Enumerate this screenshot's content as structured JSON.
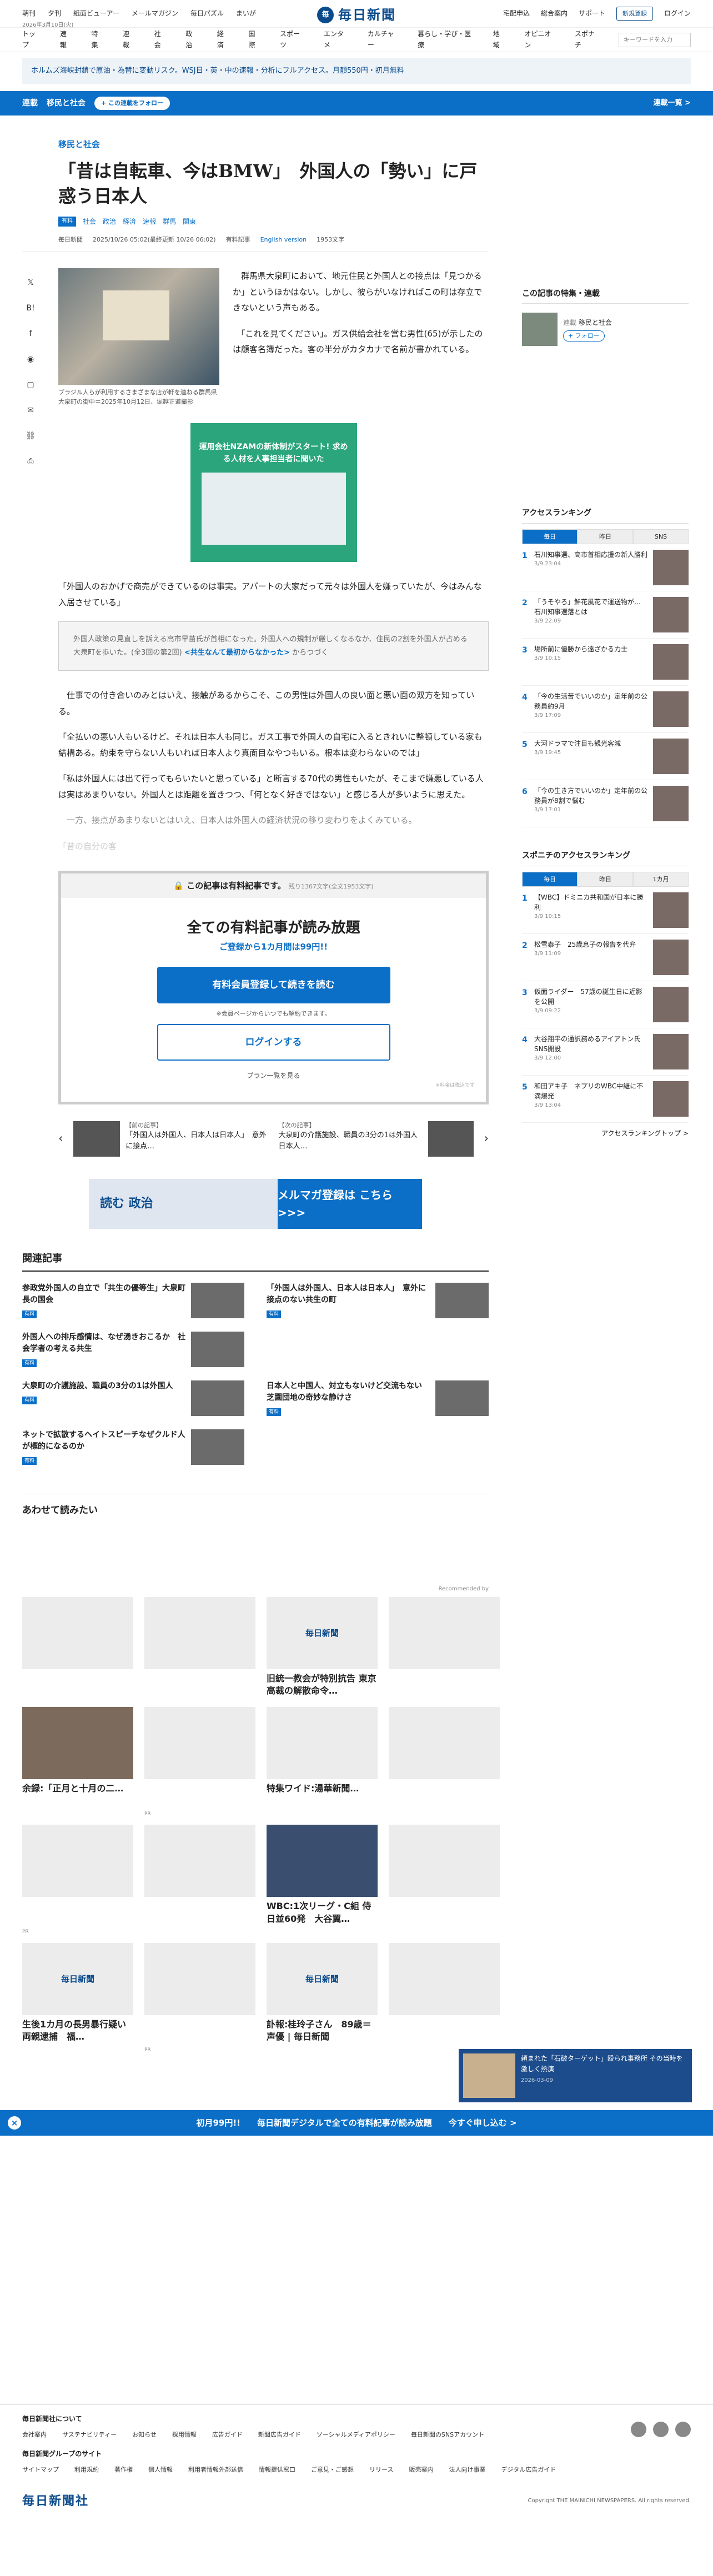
{
  "top": {
    "links": [
      "朝刊",
      "夕刊",
      "紙面ビューアー",
      "メールマガジン",
      "毎日パズル",
      "まいが"
    ],
    "date": "2026年3月10日(火)",
    "logo_mark": "毎",
    "logo": "毎日新聞",
    "right": [
      "宅配申込",
      "総合案内",
      "サポート"
    ],
    "register": "新規登録",
    "login": "ログイン"
  },
  "gnav": {
    "items": [
      "トップ",
      "速報",
      "特集",
      "連載",
      "社会",
      "政治",
      "経済",
      "国際",
      "スポーツ",
      "エンタメ",
      "カルチャー",
      "暮らし・学び・医療",
      "地域",
      "オピニオン",
      "スポナチ"
    ],
    "search_placeholder": "キーワードを入力"
  },
  "ticker": "ホルムズ海峡封鎖で原油・為替に変動リスク。WSJ日・英・中の速報・分析にフルアクセス。月額550円・初月無料",
  "section": {
    "prefix": "連載",
    "name": "移民と社会",
    "follow": "+ この連載をフォロー",
    "more": "連載一覧 >"
  },
  "article": {
    "kicker": "移民と社会",
    "title": "「昔は自転車、今はBMW」　外国人の「勢い」に戸惑う日本人",
    "pay_tag": "有料",
    "tags": [
      "社会",
      "政治",
      "経済",
      "速報",
      "群馬",
      "関東"
    ],
    "meta": {
      "author": "毎日新聞",
      "date": "2025/10/26 05:02(最終更新 10/26 06:02)",
      "paid": "有料記事",
      "english": "English version",
      "chars": "1953文字"
    },
    "caption": "ブラジル人らが利用するさまざまな店が軒を連ねる群馬県大泉町の街中＝2025年10月12日、堀越正道撮影",
    "paragraphs": [
      "　群馬県大泉町において、地元住民と外国人との接点は「見つかるか」というほかはない。しかし、彼らがいなければこの町は存立できないという声もある。",
      "　「これを見てください」。ガス供給会社を営む男性(65)が示したのは顧客名簿だった。客の半分がカタカナで名前が書かれている。"
    ],
    "ad": "運用会社NZAMの新体制がスタート! 求める人材を人事担当者に聞いた",
    "p3": "「外国人のおかげで商売ができているのは事実。アパートの大家だって元々は外国人を嫌っていたが、今はみんな入居させている」",
    "box_text": "外国人政策の見直しを訴える高市早苗氏が首相になった。外国人への規制が厳しくなるなか、住民の2割を外国人が占める大泉町を歩いた。(全3回の第2回)",
    "box_link": "<共生なんて最初からなかった>",
    "box_link_suffix": "からつづく",
    "paragraphs2": [
      "　仕事での付き合いのみとはいえ、接触があるからこそ、この男性は外国人の良い面と悪い面の双方を知っている。",
      "「全払いの悪い人もいるけど、それは日本人も同じ。ガス工事で外国人の自宅に入るときれいに整頓している家も結構ある。約束を守らない人もいれば日本人より真面目なやつもいる。根本は変わらないのでは」",
      "「私は外国人には出て行ってもらいたいと思っている」と断言する70代の男性もいたが、そこまで嫌悪している人は実はあまりいない。外国人とは距離を置きつつ、「何となく好きではない」と感じる人が多いように思えた。"
    ],
    "fade": [
      "　一方、接点があまりないとはいえ、日本人は外国人の経済状況の移り変わりをよくみている。",
      "「昔の自分の客"
    ]
  },
  "paywall": {
    "head": "この記事は有料記事です。",
    "remain": "残り1367文字(全文1953文字)",
    "title": "全ての有料記事が読み放題",
    "sub": "ご登録から1カ月間は99円!!",
    "primary": "有料会員登録して続きを読む",
    "note": "※会員ページからいつでも解約できます。",
    "login": "ログインする",
    "plans": "プラン一覧を見る",
    "fine": "※料金は税込です"
  },
  "prevnext": {
    "prev_label": "【前の記事】",
    "prev_title": "「外国人は外国人、日本人は日本人」　意外に接点…",
    "next_label": "【次の記事】",
    "next_title": "大泉町の介護施設、職員の3分の1は外国人　日本人…"
  },
  "banner": {
    "left": "読む 政治",
    "right": "メルマガ登録は こちら >>>"
  },
  "related": {
    "title": "関連記事",
    "items": [
      {
        "t": "参政党外国人の自立で「共生の優等生」大泉町長の国会",
        "pill": "有料"
      },
      {
        "t": "「外国人は外国人、日本人は日本人」　意外に接点のない共生の町",
        "pill": "有料"
      },
      {
        "t": "外国人への排斥感情は、なぜ湧きおこるか　社会学者の考える共生",
        "pill": "有料"
      },
      {
        "t": "",
        "pill": ""
      },
      {
        "t": "大泉町の介護施設、職員の3分の1は外国人",
        "pill": "有料"
      },
      {
        "t": "日本人と中国人、対立もないけど交流もない　芝園団地の奇妙な静けさ",
        "pill": "有料"
      },
      {
        "t": "ネットで拡散するヘイトスピーチなぜクルド人が標的になるのか",
        "pill": "有料"
      }
    ]
  },
  "aw": {
    "title": "あわせて読みたい",
    "recommended": "Recommended by",
    "cards": [
      {
        "t": "",
        "pr": "",
        "ph": ""
      },
      {
        "t": "",
        "pr": "",
        "ph": ""
      },
      {
        "t": "旧統一教会が特別抗告 東京高裁の解散命令…",
        "pr": "",
        "ph": "毎日新聞"
      },
      {
        "t": "",
        "pr": "",
        "ph": ""
      },
      {
        "t": "余録:「正月と十月の二…",
        "pr": "",
        "ph": ""
      },
      {
        "t": "",
        "pr": "PR",
        "ph": ""
      },
      {
        "t": "特集ワイド:湯華新聞…",
        "pr": "",
        "ph": ""
      },
      {
        "t": "",
        "pr": "",
        "ph": ""
      },
      {
        "t": "",
        "pr": "PR",
        "ph": ""
      },
      {
        "t": "",
        "pr": "",
        "ph": ""
      },
      {
        "t": "WBC:1次リーグ・C組 侍日並60発　大谷翼…",
        "pr": "",
        "ph": ""
      },
      {
        "t": "",
        "pr": "",
        "ph": ""
      },
      {
        "t": "生後1カ月の長男暴行疑い　両親逮捕　福…",
        "pr": "",
        "ph": "毎日新聞"
      },
      {
        "t": "",
        "pr": "PR",
        "ph": ""
      },
      {
        "t": "訃報:桂玲子さん　89歳＝声優 | 毎日新聞",
        "pr": "",
        "ph": "毎日新聞"
      },
      {
        "t": "",
        "pr": "",
        "ph": ""
      }
    ]
  },
  "sticky": {
    "close": "×",
    "a": "初月99円!!",
    "b": "毎日新聞デジタルで全ての有料記事が読み放題",
    "c": "今すぐ申し込む >"
  },
  "floatad": {
    "text": "頼まれた「石破ターゲット」殴られ事務所 その当時を激しく熱演",
    "time": "2026-03-09"
  },
  "side": {
    "series_title": "この記事の特集・連載",
    "series_tag": "連載",
    "series_name": "移民と社会",
    "series_follow": "+ フォロー",
    "rank_title": "アクセスランキング",
    "tabs": [
      "毎日",
      "昨日",
      "SNS"
    ],
    "rank": [
      {
        "n": "1",
        "t": "石川知事選、高市首相応援の新人勝利",
        "d": "3/9 23:04"
      },
      {
        "n": "2",
        "t": "「うそやろ」鮮花風花で運送物が…　石川知事選落とは",
        "d": "3/9 22:09"
      },
      {
        "n": "3",
        "t": "場所前に優勝から遠ざかる力士",
        "d": "3/9 10:15"
      },
      {
        "n": "4",
        "t": "「今の生活苦でいいのか」定年前の公務員約9月",
        "d": "3/9 17:09"
      },
      {
        "n": "5",
        "t": "大河ドラマで注目も観光客減",
        "d": "3/9 19:45"
      },
      {
        "n": "6",
        "t": "「今の生き方でいいのか」定年前の公務員が8割で悩む",
        "d": "3/9 17:01"
      }
    ],
    "rank2_title": "スポニチのアクセスランキング",
    "tabs2": [
      "毎日",
      "昨日",
      "1カ月"
    ],
    "rank2": [
      {
        "n": "1",
        "t": "【WBC】ドミニカ共和国が日本に勝利",
        "d": "3/9 10:15"
      },
      {
        "n": "2",
        "t": "松雪泰子　25歳息子の報告を代弁",
        "d": "3/9 11:09"
      },
      {
        "n": "3",
        "t": "仮面ライダー　57歳の誕生日に近影を公開",
        "d": "3/9 09:22"
      },
      {
        "n": "4",
        "t": "大谷翔平の通訳務めるアイアトン氏　SNS開設",
        "d": "3/9 12:00"
      },
      {
        "n": "5",
        "t": "和田アキ子　ネプリのWBC中継に不満爆発",
        "d": "3/9 13:04"
      }
    ],
    "rankmore": "アクセスランキングトップ >"
  },
  "footer": {
    "about": "毎日新聞社について",
    "row1": [
      "会社案内",
      "サステナビリティー",
      "お知らせ",
      "採用情報",
      "広告ガイド",
      "新聞広告ガイド",
      "ソーシャルメディアポリシー",
      "毎日新聞のSNSアカウント"
    ],
    "group": "毎日新聞グループのサイト",
    "row2": [
      "サイトマップ",
      "利用規約",
      "著作権",
      "個人情報",
      "利用者情報外部送信",
      "情報提供窓口",
      "ご意見・ご感想",
      "リリース",
      "販売案内",
      "法人向け事業",
      "デジタル広告ガイド"
    ],
    "logo": "毎日新聞社",
    "copy": "Copyright THE MAINICHI NEWSPAPERS. All rights reserved."
  }
}
